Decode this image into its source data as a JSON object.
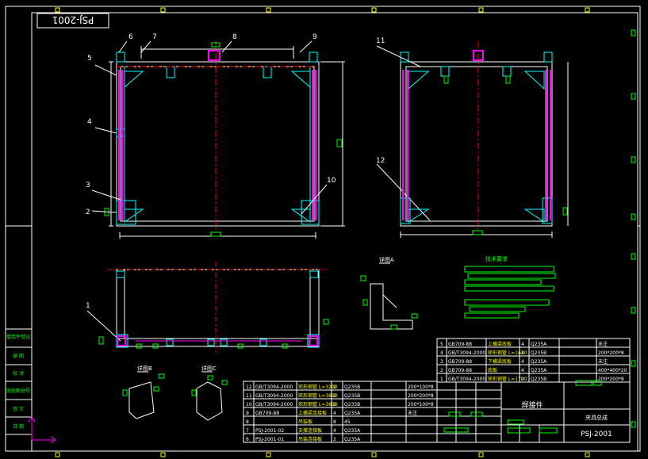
{
  "drawing_number": "PSJ-2001",
  "title_block": {
    "part_name": "焊接件",
    "project": "夹具总成",
    "drawing_no": "PSJ-2001"
  },
  "balloons": [
    "1",
    "2",
    "3",
    "4",
    "5",
    "6",
    "7",
    "8",
    "9",
    "10",
    "11",
    "12"
  ],
  "section_labels": [
    "详图A",
    "详图B",
    "详图C"
  ],
  "notes_title": "技术要求",
  "side_labels": [
    "借用件登记",
    "描 图",
    "校 对",
    "旧底图总号",
    "签 字",
    "日 期"
  ],
  "bom_top": [
    {
      "no": "5",
      "code": "GB709-88",
      "name": "上横梁底板",
      "qty": "4",
      "mat": "Q235A",
      "spec": "未注"
    },
    {
      "no": "4",
      "code": "GB/T3094-2000",
      "name": "矩形钢管 L=1630",
      "qty": "4",
      "mat": "Q235B",
      "spec": "200*200*8"
    },
    {
      "no": "3",
      "code": "GB709-88",
      "name": "下横梁底板",
      "qty": "4",
      "mat": "Q235A",
      "spec": "未注"
    },
    {
      "no": "2",
      "code": "GB709-88",
      "name": "底板",
      "qty": "4",
      "mat": "Q235A",
      "spec": "400*400*20"
    },
    {
      "no": "1",
      "code": "GB/T3094-2000",
      "name": "矩形钢管 L=1700",
      "qty": "2",
      "mat": "Q235B",
      "spec": "200*200*8"
    }
  ],
  "bom_bottom": [
    {
      "no": "12",
      "code": "GB/T3094-2000",
      "name": "矩形钢管 L=3200",
      "qty": "2",
      "mat": "Q235B",
      "spec": "200*100*8"
    },
    {
      "no": "11",
      "code": "GB/T3094-2000",
      "name": "矩形钢管 L=3600",
      "qty": "2",
      "mat": "Q235B",
      "spec": "200*200*8"
    },
    {
      "no": "10",
      "code": "GB/T3094-2000",
      "name": "矩形钢管 L=3600",
      "qty": "2",
      "mat": "Q235B",
      "spec": "200*100*8"
    },
    {
      "no": "9",
      "code": "GB709-88",
      "name": "上横梁连接板",
      "qty": "4",
      "mat": "Q235A",
      "spec": "未注"
    },
    {
      "no": "8",
      "code": "",
      "name": "吊装板",
      "qty": "8",
      "mat": "45",
      "spec": ""
    },
    {
      "no": "7",
      "code": "PSJ-2001-02",
      "name": "支撑连接板",
      "qty": "4",
      "mat": "Q235A",
      "spec": ""
    },
    {
      "no": "6",
      "code": "PSJ-2001-01",
      "name": "吊装连接板",
      "qty": "2",
      "mat": "Q235A",
      "spec": ""
    }
  ],
  "colors": {
    "frame": "#00ffff",
    "line": "#ffffff",
    "center": "#ff0000",
    "dim": "#00ff00",
    "weld": "#ff00ff",
    "tick": "#ffff00"
  }
}
